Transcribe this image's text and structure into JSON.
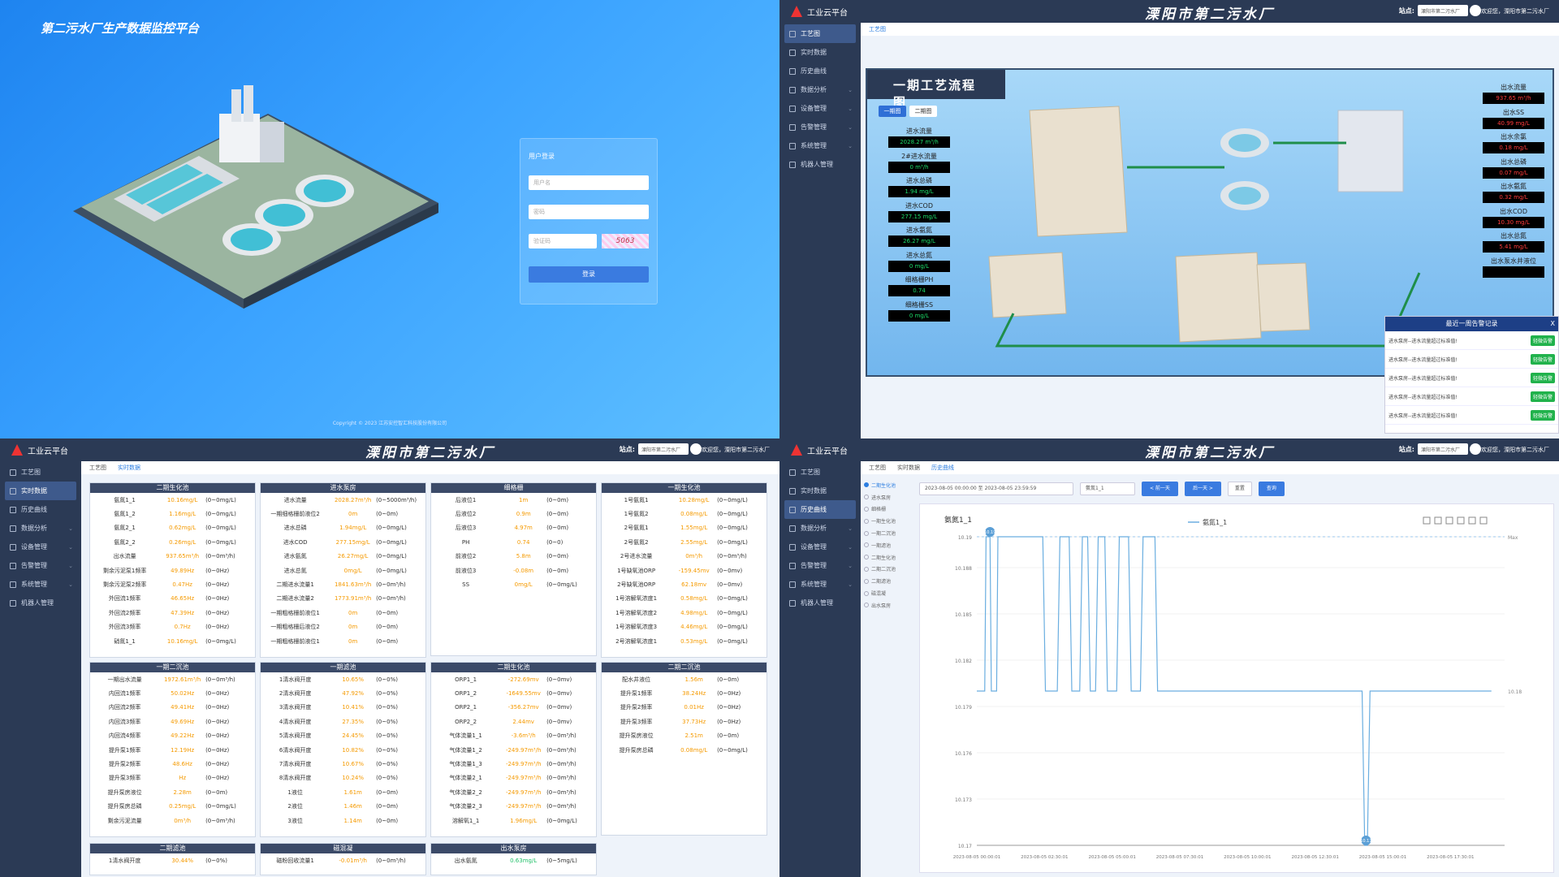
{
  "login": {
    "title": "第二污水厂生产数据监控平台",
    "form_title": "用户登录",
    "user_ph": "用户名",
    "pwd_ph": "密码",
    "code_ph": "验证码",
    "captcha": "5063",
    "submit": "登录",
    "copyright": "Copyright © 2023 江苏安控智汇科技股份有限公司"
  },
  "app": {
    "logo": "工业云平台",
    "title": "溧阳市第二污水厂",
    "station_label": "站点:",
    "station": "溧阳市第二污水厂",
    "welcome": "欢迎您，溧阳市第二污水厂"
  },
  "menu": [
    {
      "label": "工艺图",
      "icon": "process-icon"
    },
    {
      "label": "实时数据",
      "icon": "pulse-icon"
    },
    {
      "label": "历史曲线",
      "icon": "chart-line-icon"
    },
    {
      "label": "数据分析",
      "icon": "bar-chart-icon",
      "arrow": "⌄"
    },
    {
      "label": "设备管理",
      "icon": "device-icon",
      "arrow": "⌄"
    },
    {
      "label": "告警管理",
      "icon": "bell-icon",
      "arrow": "⌄"
    },
    {
      "label": "系统管理",
      "icon": "users-icon",
      "arrow": "⌄"
    },
    {
      "label": "机器人管理",
      "icon": "robot-icon"
    }
  ],
  "process": {
    "tab": "工艺图",
    "title": "一期工艺流程图",
    "btn1": "一期图",
    "btn2": "二期图",
    "left": [
      {
        "k": "进水流量",
        "v": "2028.27 m³/h"
      },
      {
        "k": "2#进水流量",
        "v": "0 m³/h"
      },
      {
        "k": "进水总磷",
        "v": "1.94 mg/L"
      },
      {
        "k": "进水COD",
        "v": "277.15 mg/L"
      },
      {
        "k": "进水氨氮",
        "v": "26.27 mg/L"
      },
      {
        "k": "进水总氮",
        "v": "0 mg/L"
      },
      {
        "k": "细格栅PH",
        "v": "0.74"
      },
      {
        "k": "细格栅SS",
        "v": "0 mg/L"
      }
    ],
    "right": [
      {
        "k": "出水流量",
        "v": "937.65 m³/h"
      },
      {
        "k": "出水SS",
        "v": "40.99 mg/L"
      },
      {
        "k": "出水余氯",
        "v": "0.18 mg/L"
      },
      {
        "k": "出水总磷",
        "v": "0.07 mg/L"
      },
      {
        "k": "出水氨氮",
        "v": "0.32 mg/L"
      },
      {
        "k": "出水COD",
        "v": "10.30 mg/L"
      },
      {
        "k": "出水总氮",
        "v": "5.41 mg/L"
      },
      {
        "k": "出水泵水井液位",
        "v": ""
      }
    ],
    "alarm": {
      "title": "最近一周告警记录",
      "close": "X",
      "rows": [
        {
          "t": "进水泵房--进水流量超过标准值!",
          "b": "轻微告警"
        },
        {
          "t": "进水泵房--进水流量超过标准值!",
          "b": "轻微告警"
        },
        {
          "t": "进水泵房--进水流量超过标准值!",
          "b": "轻微告警"
        },
        {
          "t": "进水泵房--进水流量超过标准值!",
          "b": "轻微告警"
        },
        {
          "t": "进水泵房--进水流量超过标准值!",
          "b": "轻微告警"
        }
      ]
    }
  },
  "realtime": {
    "tabs": [
      "工艺图",
      "实时数据"
    ],
    "cards": [
      {
        "title": "二期生化池",
        "rows": [
          [
            "氨氮1_1",
            "10.16mg/L",
            "(0~0mg/L)"
          ],
          [
            "氨氮1_2",
            "1.16mg/L",
            "(0~0mg/L)"
          ],
          [
            "氨氮2_1",
            "0.62mg/L",
            "(0~0mg/L)"
          ],
          [
            "氨氮2_2",
            "0.26mg/L",
            "(0~0mg/L)"
          ],
          [
            "出水流量",
            "937.65m³/h",
            "(0~0m³/h)"
          ],
          [
            "剩余污泥泵1频率",
            "49.89Hz",
            "(0~0Hz)"
          ],
          [
            "剩余污泥泵2频率",
            "0.47Hz",
            "(0~0Hz)"
          ],
          [
            "外回流1频率",
            "46.65Hz",
            "(0~0Hz)"
          ],
          [
            "外回流2频率",
            "47.39Hz",
            "(0~0Hz)"
          ],
          [
            "外回流3频率",
            "0.7Hz",
            "(0~0Hz)"
          ],
          [
            "硝氮1_1",
            "10.16mg/L",
            "(0~0mg/L)"
          ]
        ]
      },
      {
        "title": "进水泵房",
        "rows": [
          [
            "进水流量",
            "2028.27m³/h",
            "(0~5000m³/h)"
          ],
          [
            "一期细格栅前液位2",
            "0m",
            "(0~0m)"
          ],
          [
            "进水总磷",
            "1.94mg/L",
            "(0~0mg/L)"
          ],
          [
            "进水COD",
            "277.15mg/L",
            "(0~0mg/L)"
          ],
          [
            "进水氨氮",
            "26.27mg/L",
            "(0~0mg/L)"
          ],
          [
            "进水总氮",
            "0mg/L",
            "(0~0mg/L)"
          ],
          [
            "二期进水流量1",
            "1841.63m³/h",
            "(0~0m³/h)"
          ],
          [
            "二期进水流量2",
            "1773.91m³/h",
            "(0~0m³/h)"
          ],
          [
            "一期粗格栅前液位1",
            "0m",
            "(0~0m)"
          ],
          [
            "一期粗格栅后液位2",
            "0m",
            "(0~0m)"
          ],
          [
            "一期粗格栅前液位1",
            "0m",
            "(0~0m)"
          ]
        ]
      },
      {
        "title": "细格栅",
        "rows": [
          [
            "后液位1",
            "1m",
            "(0~0m)"
          ],
          [
            "后液位2",
            "0.9m",
            "(0~0m)"
          ],
          [
            "后液位3",
            "4.97m",
            "(0~0m)"
          ],
          [
            "PH",
            "0.74",
            "(0~0)"
          ],
          [
            "前液位2",
            "5.8m",
            "(0~0m)"
          ],
          [
            "前液位3",
            "-0.08m",
            "(0~0m)"
          ],
          [
            "SS",
            "0mg/L",
            "(0~0mg/L)"
          ]
        ]
      },
      {
        "title": "一期生化池",
        "rows": [
          [
            "1号氨氮1",
            "10.28mg/L",
            "(0~0mg/L)"
          ],
          [
            "1号氨氮2",
            "0.08mg/L",
            "(0~0mg/L)"
          ],
          [
            "2号氨氮1",
            "1.55mg/L",
            "(0~0mg/L)"
          ],
          [
            "2号氨氮2",
            "2.55mg/L",
            "(0~0mg/L)"
          ],
          [
            "2号进水流量",
            "0m³/h",
            "(0~0m³/h)"
          ],
          [
            "1号缺氧池ORP",
            "-159.45mv",
            "(0~0mv)"
          ],
          [
            "2号缺氧池ORP",
            "62.18mv",
            "(0~0mv)"
          ],
          [
            "1号溶解氧浓度1",
            "0.58mg/L",
            "(0~0mg/L)"
          ],
          [
            "1号溶解氧浓度2",
            "4.98mg/L",
            "(0~0mg/L)"
          ],
          [
            "1号溶解氧浓度3",
            "4.46mg/L",
            "(0~0mg/L)"
          ],
          [
            "2号溶解氧浓度1",
            "0.53mg/L",
            "(0~0mg/L)"
          ]
        ]
      },
      {
        "title": "一期二沉池",
        "rows": [
          [
            "一期出水流量",
            "1972.61m³/h",
            "(0~0m³/h)"
          ],
          [
            "内回流1频率",
            "50.02Hz",
            "(0~0Hz)"
          ],
          [
            "内回流2频率",
            "49.41Hz",
            "(0~0Hz)"
          ],
          [
            "内回流3频率",
            "49.69Hz",
            "(0~0Hz)"
          ],
          [
            "内回流4频率",
            "49.22Hz",
            "(0~0Hz)"
          ],
          [
            "提升泵1频率",
            "12.19Hz",
            "(0~0Hz)"
          ],
          [
            "提升泵2频率",
            "48.6Hz",
            "(0~0Hz)"
          ],
          [
            "提升泵3频率",
            "Hz",
            "(0~0Hz)"
          ],
          [
            "提升泵房液位",
            "2.28m",
            "(0~0m)"
          ],
          [
            "提升泵房总磷",
            "0.25mg/L",
            "(0~0mg/L)"
          ],
          [
            "剩余污泥流量",
            "0m³/h",
            "(0~0m³/h)"
          ]
        ]
      },
      {
        "title": "一期滤池",
        "rows": [
          [
            "1清水阀开度",
            "10.65%",
            "(0~0%)"
          ],
          [
            "2清水阀开度",
            "47.92%",
            "(0~0%)"
          ],
          [
            "3清水阀开度",
            "10.41%",
            "(0~0%)"
          ],
          [
            "4清水阀开度",
            "27.35%",
            "(0~0%)"
          ],
          [
            "5清水阀开度",
            "24.45%",
            "(0~0%)"
          ],
          [
            "6清水阀开度",
            "10.82%",
            "(0~0%)"
          ],
          [
            "7清水阀开度",
            "10.67%",
            "(0~0%)"
          ],
          [
            "8清水阀开度",
            "10.24%",
            "(0~0%)"
          ],
          [
            "1液位",
            "1.61m",
            "(0~0m)"
          ],
          [
            "2液位",
            "1.46m",
            "(0~0m)"
          ],
          [
            "3液位",
            "1.14m",
            "(0~0m)"
          ]
        ]
      },
      {
        "title": "二期生化池",
        "rows": [
          [
            "ORP1_1",
            "-272.69mv",
            "(0~0mv)"
          ],
          [
            "ORP1_2",
            "-1649.55mv",
            "(0~0mv)"
          ],
          [
            "ORP2_1",
            "-356.27mv",
            "(0~0mv)"
          ],
          [
            "ORP2_2",
            "2.44mv",
            "(0~0mv)"
          ],
          [
            "气体流量1_1",
            "-3.6m³/h",
            "(0~0m³/h)"
          ],
          [
            "气体流量1_2",
            "-249.97m³/h",
            "(0~0m³/h)"
          ],
          [
            "气体流量1_3",
            "-249.97m³/h",
            "(0~0m³/h)"
          ],
          [
            "气体流量2_1",
            "-249.97m³/h",
            "(0~0m³/h)"
          ],
          [
            "气体流量2_2",
            "-249.97m³/h",
            "(0~0m³/h)"
          ],
          [
            "气体流量2_3",
            "-249.97m³/h",
            "(0~0m³/h)"
          ],
          [
            "溶解氧1_1",
            "1.96mg/L",
            "(0~0mg/L)"
          ]
        ]
      },
      {
        "title": "二期二沉池",
        "rows": [
          [
            "配水井液位",
            "1.56m",
            "(0~0m)"
          ],
          [
            "提升泵1频率",
            "38.24Hz",
            "(0~0Hz)"
          ],
          [
            "提升泵2频率",
            "0.01Hz",
            "(0~0Hz)"
          ],
          [
            "提升泵3频率",
            "37.73Hz",
            "(0~0Hz)"
          ],
          [
            "提升泵房液位",
            "2.51m",
            "(0~0m)"
          ],
          [
            "提升泵房总磷",
            "0.08mg/L",
            "(0~0mg/L)"
          ]
        ]
      },
      {
        "title": "二期滤池",
        "rows": [
          [
            "1清水阀开度",
            "30.44%",
            "(0~0%)"
          ]
        ]
      },
      {
        "title": "磁混凝",
        "rows": [
          [
            "磁粉回收流量1",
            "-0.01m³/h",
            "(0~0m³/h)"
          ]
        ]
      },
      {
        "title": "出水泵房",
        "rows": [
          [
            "出水氨氮",
            "0.63mg/L",
            "(0~5mg/L)"
          ]
        ]
      }
    ]
  },
  "history": {
    "tabs": [
      "工艺图",
      "实时数据",
      "历史曲线"
    ],
    "tree": [
      "二期生化池",
      "进水泵房",
      "细格栅",
      "一期生化池",
      "一期二沉池",
      "一期滤池",
      "二期生化池",
      "二期二沉池",
      "二期滤池",
      "磁混凝",
      "出水泵房"
    ],
    "start": "2023-08-05 00:00:00",
    "to": "至",
    "end": "2023-08-05 23:59:59",
    "point": "氨氮1_1",
    "prev": "< 前一天",
    "next": "后一天 >",
    "reset": "重置",
    "query": "查询",
    "series": "氨氮1_1",
    "max_label": "Max",
    "chart_data": {
      "type": "line",
      "series": [
        {
          "name": "氨氮1_1",
          "unit": "mg/L"
        }
      ],
      "ylabel": "氨氮1_1",
      "yticks": [
        "10.19",
        "10.188",
        "10.185",
        "10.182",
        "10.179",
        "10.176",
        "10.173",
        "10.17"
      ],
      "ylim": [
        10.17,
        10.19
      ],
      "xticks": [
        "2023-08-05 00:00:01",
        "2023-08-05 02:30:01",
        "2023-08-05 05:00:01",
        "2023-08-05 07:30:01",
        "2023-08-05 10:00:01",
        "2023-08-05 12:30:01",
        "2023-08-05 15:00:01",
        "2023-08-05 17:30:01"
      ],
      "baseline": 10.18,
      "max": 10.19,
      "min": 10.17,
      "max_pin": "10.19",
      "min_pin": "10.17",
      "end_label": "10.18",
      "x": [
        0,
        0.3,
        0.35,
        0.5,
        0.55,
        0.75,
        0.8,
        2.5,
        2.6,
        3.05,
        3.15,
        3.5,
        3.6,
        3.9,
        4.0,
        4.2,
        4.3,
        4.5,
        4.6,
        4.85,
        4.95,
        5.3,
        5.4,
        5.75,
        5.85,
        6.2,
        6.3,
        6.75,
        6.85,
        14.6,
        14.7,
        14.8,
        14.9,
        19.5
      ],
      "y": [
        10.18,
        10.18,
        10.19,
        10.19,
        10.18,
        10.18,
        10.19,
        10.19,
        10.18,
        10.18,
        10.19,
        10.19,
        10.18,
        10.18,
        10.19,
        10.19,
        10.18,
        10.18,
        10.19,
        10.19,
        10.18,
        10.18,
        10.19,
        10.19,
        10.18,
        10.18,
        10.19,
        10.19,
        10.18,
        10.18,
        10.17,
        10.17,
        10.18,
        10.18
      ]
    }
  }
}
